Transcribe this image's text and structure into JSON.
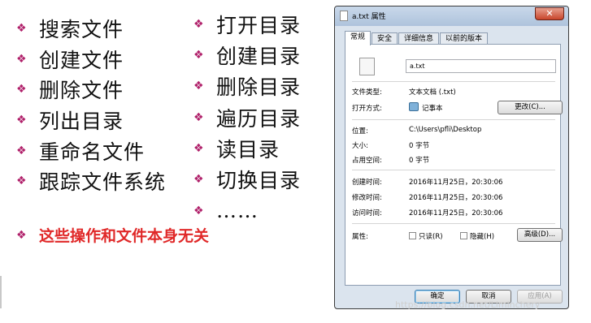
{
  "left_list": [
    "搜索文件",
    "创建文件",
    "删除文件",
    "列出目录",
    "重命名文件",
    "跟踪文件系统"
  ],
  "right_list": [
    "打开目录",
    "创建目录",
    "删除目录",
    "遍历目录",
    "读目录",
    "切换目录",
    "……"
  ],
  "note": "这些操作和文件本身无关",
  "bullet_symbol": "❖",
  "colors": {
    "bullet": "#b0206a",
    "note": "#e02828"
  },
  "dialog": {
    "title": "a.txt 属性",
    "close": "✕",
    "tabs": [
      "常规",
      "安全",
      "详细信息",
      "以前的版本"
    ],
    "filename": "a.txt",
    "type_label": "文件类型:",
    "type_value": "文本文档 (.txt)",
    "open_label": "打开方式:",
    "open_value": "记事本",
    "change_btn": "更改(C)...",
    "location_label": "位置:",
    "location_value": "C:\\Users\\pfli\\Desktop",
    "size_label": "大小:",
    "size_value": "0 字节",
    "disk_label": "占用空间:",
    "disk_value": "0 字节",
    "created_label": "创建时间:",
    "created_value": "2016年11月25日，20:30:06",
    "modified_label": "修改时间:",
    "modified_value": "2016年11月25日，20:30:06",
    "accessed_label": "访问时间:",
    "accessed_value": "2016年11月25日，20:30:06",
    "attr_label": "属性:",
    "readonly": "只读(R)",
    "hidden": "隐藏(H)",
    "advanced_btn": "高级(D)...",
    "ok_btn": "确定",
    "cancel_btn": "取消",
    "apply_btn": "应用(A)"
  },
  "watermark": "https://blog.csdn.net/Liminchery"
}
